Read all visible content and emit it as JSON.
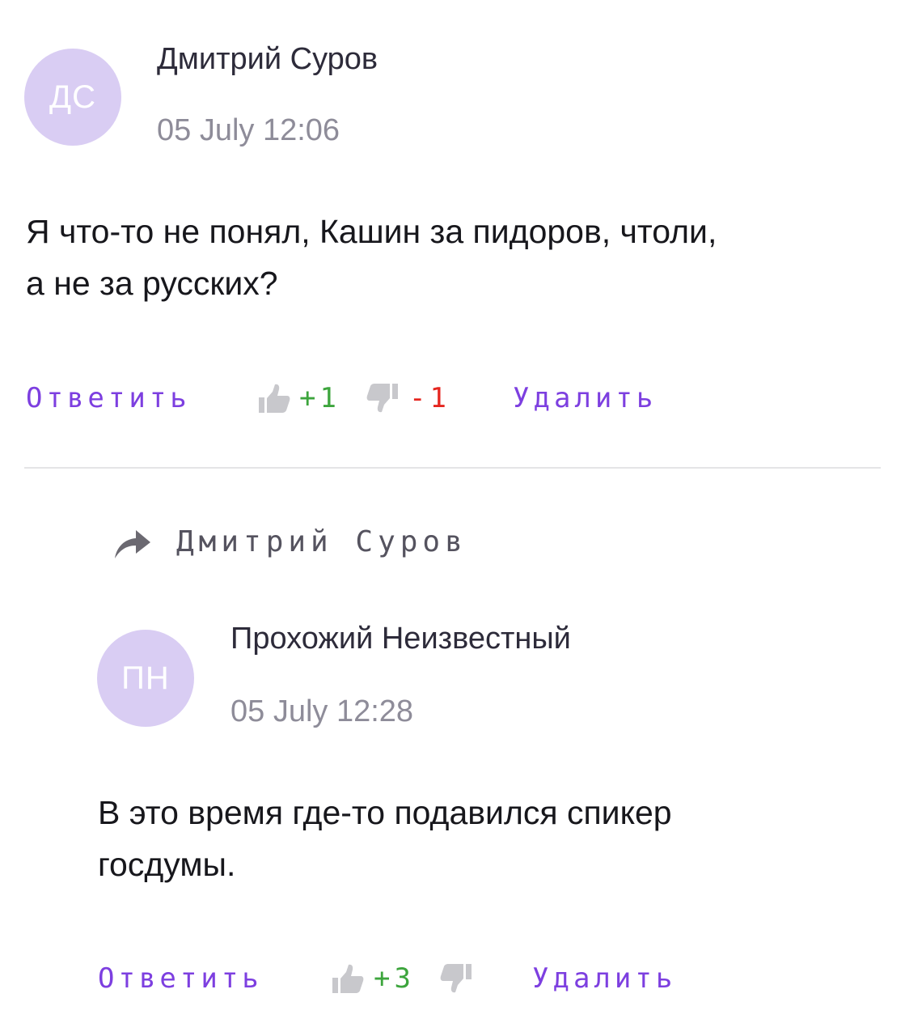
{
  "comments": [
    {
      "initials": "ДС",
      "author": "Дмитрий Суров",
      "date": "05 July 12:06",
      "text_line1": "Я что-то не понял, Кашин за пидоров, чтоли,",
      "text_line2": "а не за русских?",
      "reply_label": "Ответить",
      "upvotes": "+1",
      "downvotes": "-1",
      "delete_label": "Удалить"
    },
    {
      "reply_to": "Дмитрий Суров",
      "initials": "ПН",
      "author": "Прохожий Неизвестный",
      "date": "05 July 12:28",
      "text_line1": "В это время где-то подавился спикер",
      "text_line2": "госдумы.",
      "reply_label": "Ответить",
      "upvotes": "+3",
      "delete_label": "Удалить"
    }
  ],
  "colors": {
    "avatar_bg": "#d9cdf3",
    "link": "#7d3fe0",
    "upvote": "#3da53d",
    "downvote": "#e5261f",
    "muted": "#8e8c99"
  },
  "icons": {
    "upvote": "thumbs-up-icon",
    "downvote": "thumbs-down-icon",
    "reply_to": "reply-arrow-icon"
  }
}
